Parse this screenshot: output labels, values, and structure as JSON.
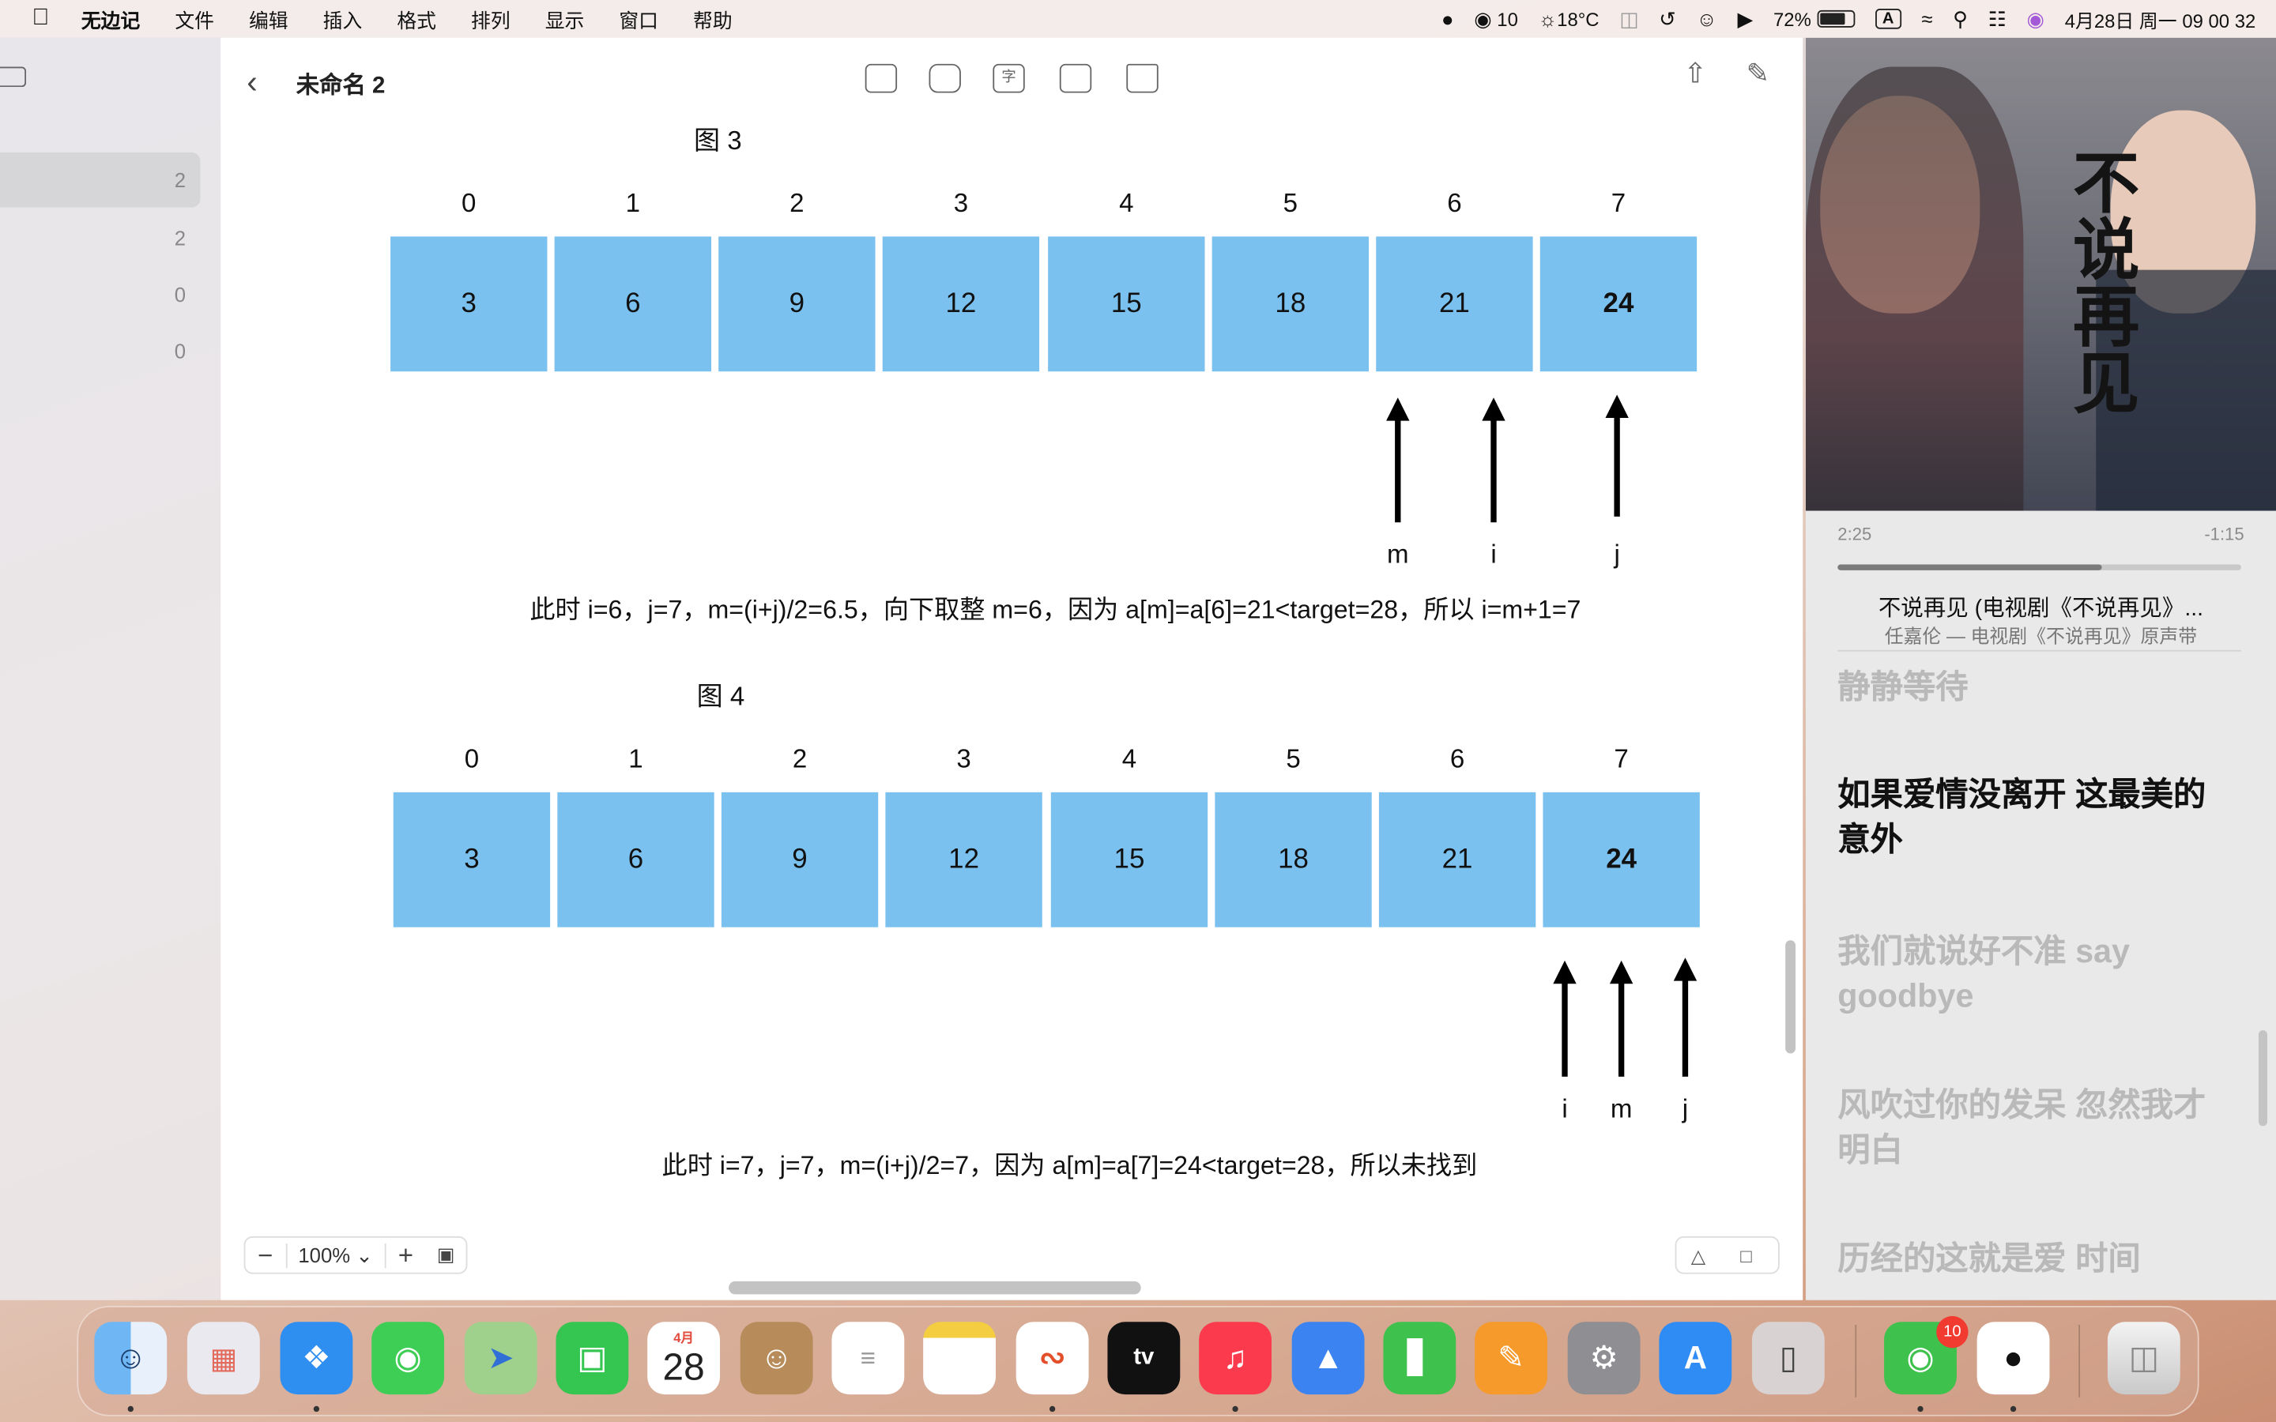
{
  "menubar": {
    "items": [
      "无边记",
      "文件",
      "编辑",
      "插入",
      "格式",
      "排列",
      "显示",
      "窗口",
      "帮助"
    ],
    "wechat_count": "10",
    "weather": "18°C",
    "battery": "72%",
    "input_method": "A",
    "datetime": "4月28日 周一  09 00 32"
  },
  "sidebar": {
    "counts": [
      "2",
      "2",
      "0",
      "0"
    ]
  },
  "document": {
    "title": "未命名 2",
    "zoom": "100%",
    "figures": [
      {
        "label": "图 3",
        "indices": [
          "0",
          "1",
          "2",
          "3",
          "4",
          "5",
          "6",
          "7"
        ],
        "values": [
          "3",
          "6",
          "9",
          "12",
          "15",
          "18",
          "21",
          "24"
        ],
        "pointers": [
          "m",
          "i",
          "j"
        ],
        "description": "此时 i=6，j=7，m=(i+j)/2=6.5，向下取整 m=6，因为 a[m]=a[6]=21<target=28，所以 i=m+1=7"
      },
      {
        "label": "图 4",
        "indices": [
          "0",
          "1",
          "2",
          "3",
          "4",
          "5",
          "6",
          "7"
        ],
        "values": [
          "3",
          "6",
          "9",
          "12",
          "15",
          "18",
          "21",
          "24"
        ],
        "pointers": [
          "i",
          "m",
          "j"
        ],
        "description": "此时 i=7，j=7，m=(i+j)/2=7，因为 a[m]=a[7]=24<target=28，所以未找到"
      }
    ]
  },
  "music": {
    "album_title": "不说再见",
    "elapsed": "2:25",
    "remaining": "-1:15",
    "progress": 0.654,
    "song_title": "不说再见 (电视剧《不说再见》...",
    "artist": "任嘉伦 — 电视剧《不说再见》原声带",
    "lyrics": [
      {
        "text": "静静等待",
        "active": false
      },
      {
        "text": "如果爱情没离开 这最美的意外",
        "active": true
      },
      {
        "text": "我们就说好不准 say goodbye",
        "active": false
      },
      {
        "text": "风吹过你的发呆 忽然我才明白",
        "active": false
      },
      {
        "text": "历经的这就是爱 时间",
        "active": false
      }
    ]
  },
  "dock": {
    "calendar_month": "4月",
    "calendar_day": "28",
    "wechat_badge": "10",
    "apps": [
      "finder",
      "launchpad",
      "safari",
      "messages",
      "maps",
      "facetime",
      "calendar",
      "contacts",
      "reminders",
      "notes",
      "freeform",
      "appletv",
      "music",
      "keynote",
      "numbers",
      "pages",
      "settings",
      "appstore",
      "iphone-mirroring",
      "wechat",
      "qq",
      "trash"
    ]
  }
}
